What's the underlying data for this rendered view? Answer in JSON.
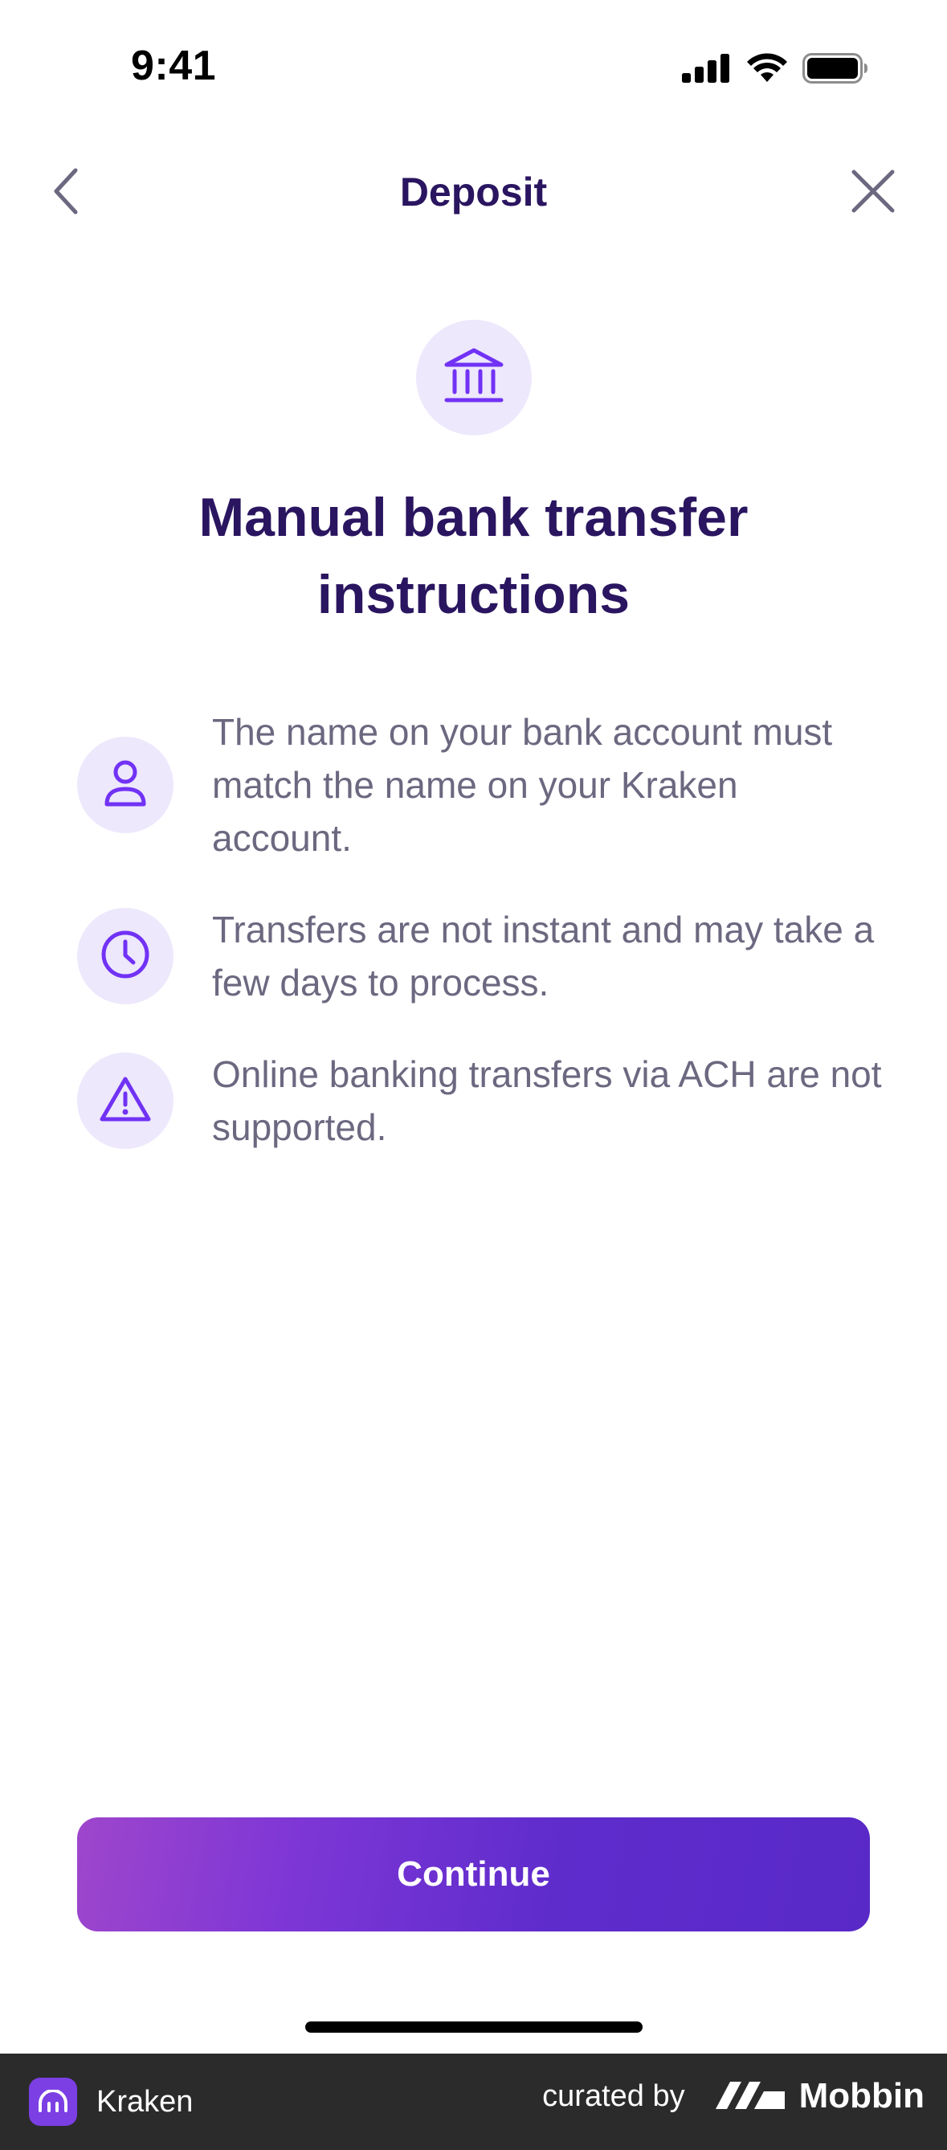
{
  "status_bar": {
    "time": "9:41",
    "icons": [
      "cellular-signal-icon",
      "wifi-icon",
      "battery-icon"
    ]
  },
  "header": {
    "title": "Deposit",
    "back_icon": "chevron-left-icon",
    "close_icon": "close-icon"
  },
  "hero": {
    "icon": "bank-icon",
    "headline": "Manual bank transfer instructions"
  },
  "instructions": [
    {
      "icon": "user-icon",
      "text": "The name on your bank account must match the name on your Kraken account."
    },
    {
      "icon": "clock-icon",
      "text": "Transfers are not instant and may take a few days to process."
    },
    {
      "icon": "warning-icon",
      "text": "Online banking transfers via ACH are not supported."
    }
  ],
  "actions": {
    "continue_label": "Continue"
  },
  "footer": {
    "app_name": "Kraken",
    "curated_by": "curated by",
    "brand": "Mobbin"
  },
  "colors": {
    "accent": "#7132f5",
    "title": "#2a1560",
    "body_text": "#6b6880",
    "icon_bg": "#ede8fc",
    "footer_bg": "#2b2b2b"
  }
}
